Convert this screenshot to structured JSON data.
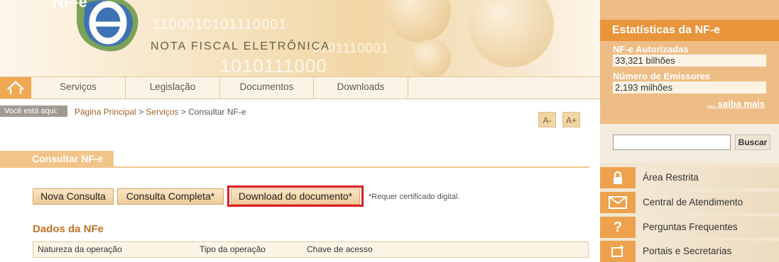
{
  "header": {
    "brand_mark": "NF-e",
    "brand_title": "NOTA FISCAL ELETRÔNICA",
    "binary_1": "1100010101110001",
    "binary_2": "0101110001",
    "binary_3": "1010111000"
  },
  "nav": {
    "home_icon": "home-icon",
    "items": [
      "Serviços",
      "Legislação",
      "Documentos",
      "Downloads"
    ]
  },
  "breadcrumb": {
    "label": "Você está aqui:",
    "home": "Página Principal",
    "sep1": ">",
    "section": "Serviços",
    "sep2": ">",
    "current": "Consultar NF-e"
  },
  "font_controls": {
    "decrease": "A-",
    "increase": "A+"
  },
  "main": {
    "title": "Consultar NF-e",
    "buttons": {
      "nova": "Nova Consulta",
      "completa": "Consulta Completa*",
      "download": "Download do documento*"
    },
    "note": "*Requer certificado digital.",
    "dados_title": "Dados da NFe",
    "table_headers": [
      "Natureza da operação",
      "Tipo da operação",
      "Chave de acesso"
    ]
  },
  "sidebar": {
    "stats_title": "Estatísticas da NF-e",
    "stats": [
      {
        "label": "NF-e Autorizadas",
        "value": "33,321 bilhões"
      },
      {
        "label": "Número de Emissores",
        "value": "2,193 milhões"
      }
    ],
    "saiba_mais": "... saiba mais",
    "search_button": "Buscar",
    "menu": [
      {
        "icon": "lock-icon",
        "label": "Área Restrita"
      },
      {
        "icon": "envelope-icon",
        "label": "Central de Atendimento"
      },
      {
        "icon": "question-icon",
        "label": "Perguntas Frequentes"
      },
      {
        "icon": "portal-icon",
        "label": "Portais e Secretarias"
      }
    ]
  },
  "colors": {
    "accent": "#e8953c",
    "highlight": "#e11b22",
    "link": "#a0622a"
  }
}
